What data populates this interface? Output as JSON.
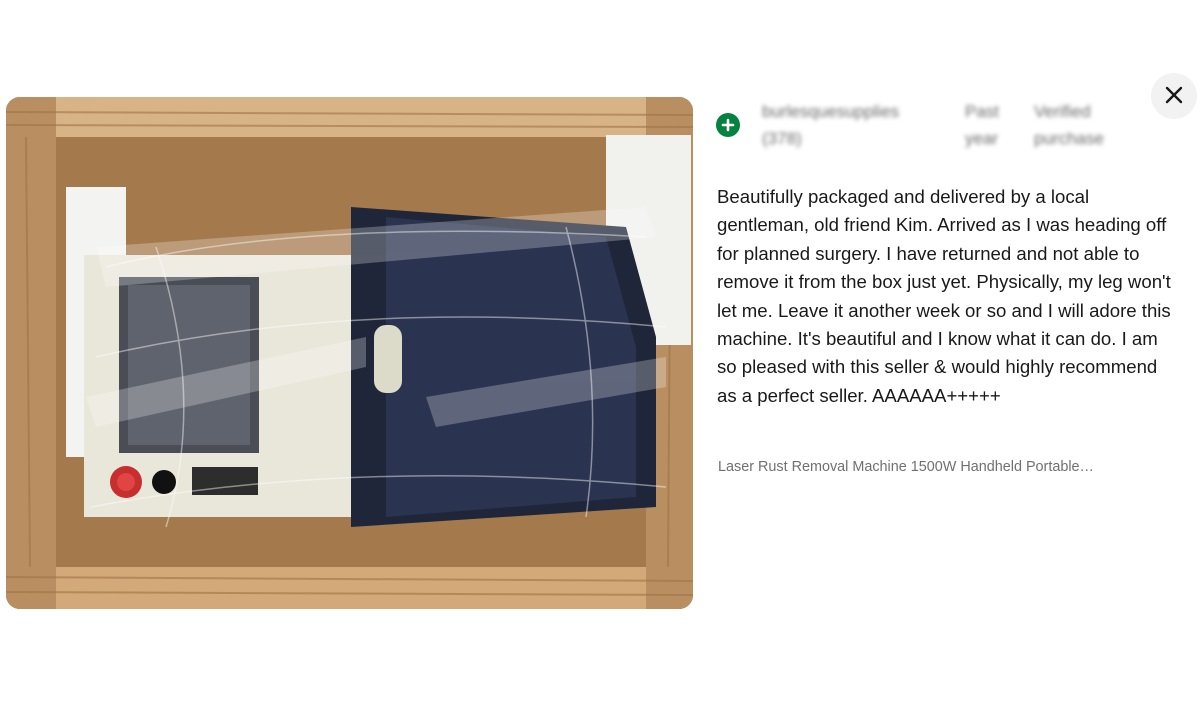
{
  "review": {
    "reviewer": "burlesquesupplies (378)",
    "timeframe": "Past year",
    "verified": "Verified purchase",
    "text": "Beautifully packaged and delivered by a local gentleman, old friend Kim. Arrived as I was heading off for planned surgery. I have returned and not able to remove it from the box just yet. Physically, my leg won't let me. Leave it another week or so and I will adore this machine. It's beautiful and I know what it can do. I am so pleased with this seller & would highly recommend as a perfect seller. AAAAAA+++++",
    "item_title": "Laser Rust Removal Machine 1500W Handheld Portable…"
  },
  "icons": {
    "close": "close-icon",
    "positive_rating": "plus-icon"
  },
  "colors": {
    "positive_green": "#05823f",
    "text_primary": "#191919",
    "text_secondary": "#707070"
  }
}
